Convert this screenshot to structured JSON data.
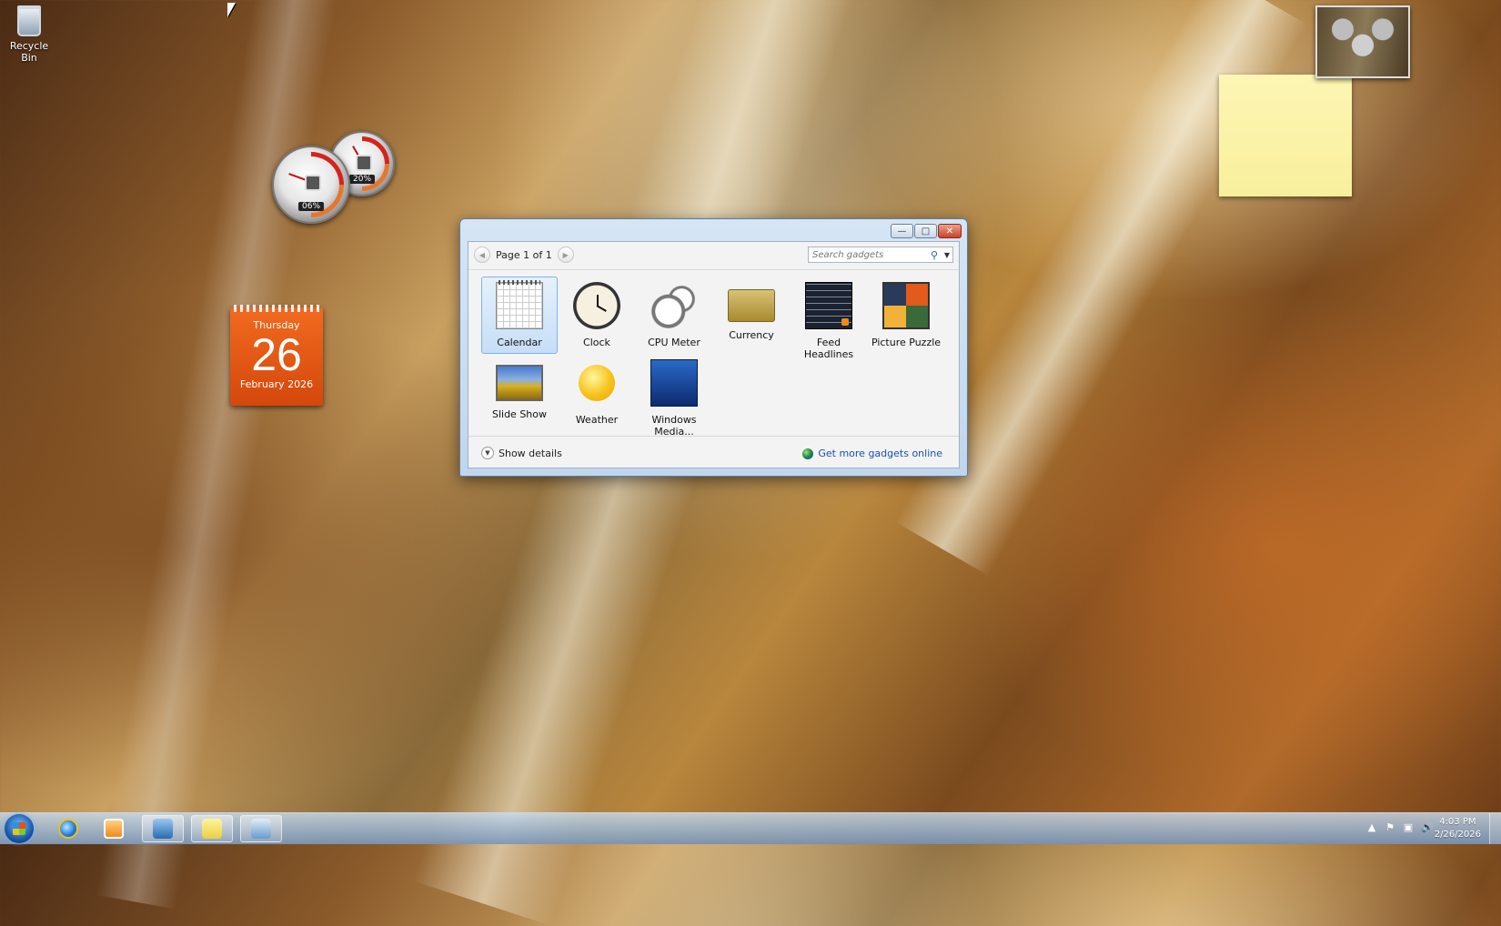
{
  "desktop": {
    "recycle_bin_label": "Recycle Bin"
  },
  "cpu_meter": {
    "cpu_percent": "06%",
    "memory_percent": "20%"
  },
  "calendar_gadget": {
    "weekday": "Thursday",
    "day": "26",
    "month_year": "February 2026"
  },
  "window": {
    "minimize_glyph": "—",
    "maximize_glyph": "□",
    "close_glyph": "✕",
    "pager": {
      "prev_glyph": "◀",
      "label": "Page 1 of 1",
      "next_glyph": "▶"
    },
    "search": {
      "placeholder": "Search gadgets",
      "icon_glyph": "⚲",
      "dropdown_glyph": "▼"
    },
    "gadgets": [
      {
        "label": "Calendar",
        "icon": "calendar-icon",
        "selected": true
      },
      {
        "label": "Clock",
        "icon": "clock-icon",
        "selected": false
      },
      {
        "label": "CPU Meter",
        "icon": "cpu-meter-icon",
        "selected": false
      },
      {
        "label": "Currency",
        "icon": "currency-icon",
        "selected": false
      },
      {
        "label": "Feed Headlines",
        "icon": "feed-headlines-icon",
        "selected": false
      },
      {
        "label": "Picture Puzzle",
        "icon": "picture-puzzle-icon",
        "selected": false
      },
      {
        "label": "Slide Show",
        "icon": "slide-show-icon",
        "selected": false
      },
      {
        "label": "Weather",
        "icon": "weather-icon",
        "selected": false
      },
      {
        "label": "Windows Media...",
        "icon": "windows-media-center-icon",
        "selected": false
      }
    ],
    "show_details_chevron": "▼",
    "show_details_label": "Show details",
    "get_more_label": "Get more gadgets online"
  },
  "taskbar": {
    "tray_icons": [
      "▲",
      "⚑",
      "▣",
      "🔊"
    ],
    "time": "4:03 PM",
    "date": "2/26/2026"
  },
  "colors": {
    "selection_bg": "#c6def6",
    "link": "#1a4fb0",
    "calendar_orange": "#e2581a"
  }
}
